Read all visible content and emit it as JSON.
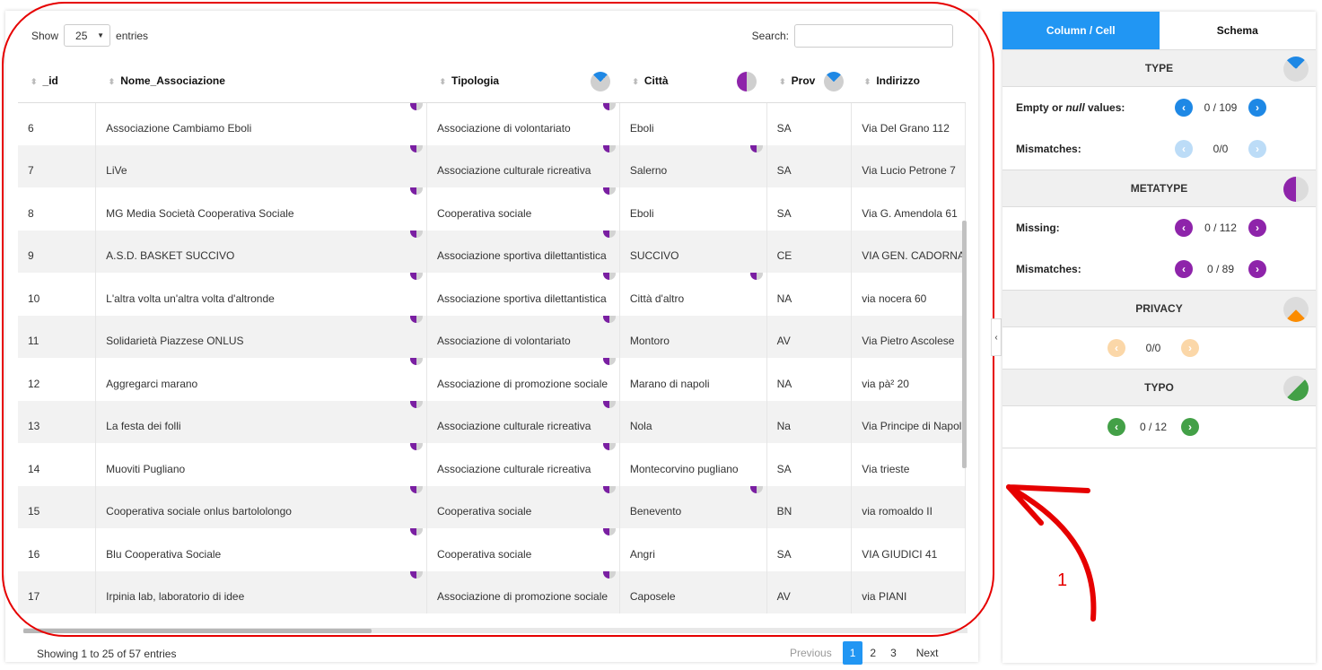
{
  "table_controls": {
    "show_label": "Show",
    "entries_value": "25",
    "entries_label": "entries",
    "search_label": "Search:",
    "search_value": ""
  },
  "columns": [
    {
      "label": "_id"
    },
    {
      "label": "Nome_Associazione"
    },
    {
      "label": "Tipologia"
    },
    {
      "label": "Città"
    },
    {
      "label": "Prov"
    },
    {
      "label": "Indirizzo"
    }
  ],
  "rows": [
    [
      "6",
      "Associazione Cambiamo Eboli",
      "Associazione di volontariato",
      "Eboli",
      "SA",
      "Via Del Grano 112"
    ],
    [
      "7",
      "LiVe",
      "Associazione culturale ricreativa",
      "Salerno",
      "SA",
      "Via Lucio Petrone 7"
    ],
    [
      "8",
      "MG Media Società  Cooperativa Sociale",
      "Cooperativa sociale",
      "Eboli",
      "SA",
      "Via G. Amendola 61"
    ],
    [
      "9",
      "A.S.D. BASKET SUCCIVO",
      "Associazione sportiva dilettantistica",
      "SUCCIVO",
      "CE",
      "VIA GEN. CADORNA"
    ],
    [
      "10",
      "L'altra volta un'altra volta d'altronde",
      "Associazione sportiva dilettantistica",
      "Città  d'altro",
      "NA",
      "via nocera 60"
    ],
    [
      "11",
      "Solidarietà  Piazzese ONLUS",
      "Associazione di volontariato",
      "Montoro",
      "AV",
      "Via Pietro Ascolese"
    ],
    [
      "12",
      "Aggregarci marano",
      "Associazione di promozione sociale",
      "Marano di napoli",
      "NA",
      "via pà² 20"
    ],
    [
      "13",
      "La festa dei folli",
      "Associazione culturale ricreativa",
      "Nola",
      "Na",
      "Via Principe di Napoli"
    ],
    [
      "14",
      "Muoviti Pugliano",
      "Associazione culturale ricreativa",
      "Montecorvino pugliano",
      "SA",
      "Via trieste"
    ],
    [
      "15",
      "Cooperativa sociale onlus bartololongo",
      "Cooperativa sociale",
      "Benevento",
      "BN",
      "via romoaldo II"
    ],
    [
      "16",
      "Blu Cooperativa Sociale",
      "Cooperativa sociale",
      "Angri",
      "SA",
      "VIA GIUDICI 41"
    ],
    [
      "17",
      "Irpinia lab, laboratorio di idee",
      "Associazione di promozione sociale",
      "Caposele",
      "AV",
      "via PIANI"
    ]
  ],
  "footer": {
    "info": "Showing 1 to 25 of 57 entries",
    "previous": "Previous",
    "pages": [
      "1",
      "2",
      "3"
    ],
    "next": "Next"
  },
  "panel": {
    "tabs": [
      "Column / Cell",
      "Schema"
    ],
    "type": {
      "title": "TYPE",
      "empty_label_pre": "Empty or ",
      "empty_label_em": "null",
      "empty_label_post": " values:",
      "empty_count": "0 / 109",
      "mismatch_label": "Mismatches:",
      "mismatch_count": "0/0"
    },
    "metatype": {
      "title": "METATYPE",
      "missing_label": "Missing:",
      "missing_count": "0 / 112",
      "mismatch_label": "Mismatches:",
      "mismatch_count": "0 / 89"
    },
    "privacy": {
      "title": "PRIVACY",
      "count": "0/0"
    },
    "typo": {
      "title": "TYPO",
      "count": "0 / 12"
    }
  },
  "annotation": {
    "step_number": "1"
  },
  "colors": {
    "accent_blue": "#2196f3",
    "metatype_purple": "#8e24aa",
    "privacy_orange": "#fb8c00",
    "typo_green": "#43a047",
    "annotation_red": "#e60000"
  }
}
